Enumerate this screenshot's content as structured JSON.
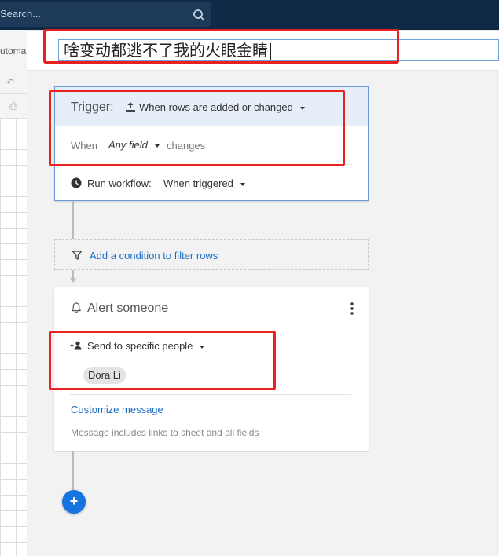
{
  "search": {
    "placeholder": "Search..."
  },
  "background": {
    "tab_label": "utoma"
  },
  "workflow": {
    "name": "啥变动都逃不了我的火眼金睛"
  },
  "trigger": {
    "label": "Trigger:",
    "value": "When rows are added or changed",
    "when_label": "When",
    "field_value": "Any field",
    "changes_label": "changes",
    "run_label": "Run workflow:",
    "run_value": "When triggered"
  },
  "condition": {
    "link_label": "Add a condition to filter rows"
  },
  "alert": {
    "title": "Alert someone",
    "send_value": "Send to specific people",
    "recipients": [
      "Dora Li"
    ],
    "customize_label": "Customize message",
    "note": "Message includes links to sheet and all fields"
  },
  "add_button": {
    "label": "+"
  },
  "colors": {
    "topbar": "#0e2a47",
    "accent_blue": "#1673e0",
    "link_blue": "#1a6ec8",
    "highlight_red": "#e82020",
    "trigger_header": "#e5eef9"
  },
  "icons": [
    "search-icon",
    "upload-icon",
    "dropdown-arrow-icon",
    "clock-icon",
    "filter-icon",
    "bell-icon",
    "more-vertical-icon",
    "add-person-icon",
    "plus-icon"
  ]
}
